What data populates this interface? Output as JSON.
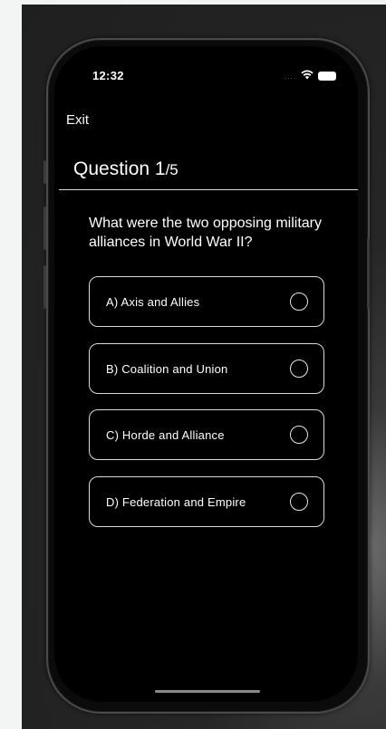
{
  "status_bar": {
    "time": "12:32",
    "signal": "....",
    "wifi_icon": "wifi-icon",
    "battery_icon": "battery-icon"
  },
  "nav": {
    "exit_label": "Exit"
  },
  "quiz": {
    "question_word": "Question 1",
    "question_total": "/5",
    "question_text": "What were the two opposing military alliances in World War II?",
    "options": [
      {
        "label": "A) Axis and Allies"
      },
      {
        "label": "B) Coalition and Union"
      },
      {
        "label": "C) Horde and Alliance"
      },
      {
        "label": "D) Federation and Empire"
      }
    ]
  }
}
